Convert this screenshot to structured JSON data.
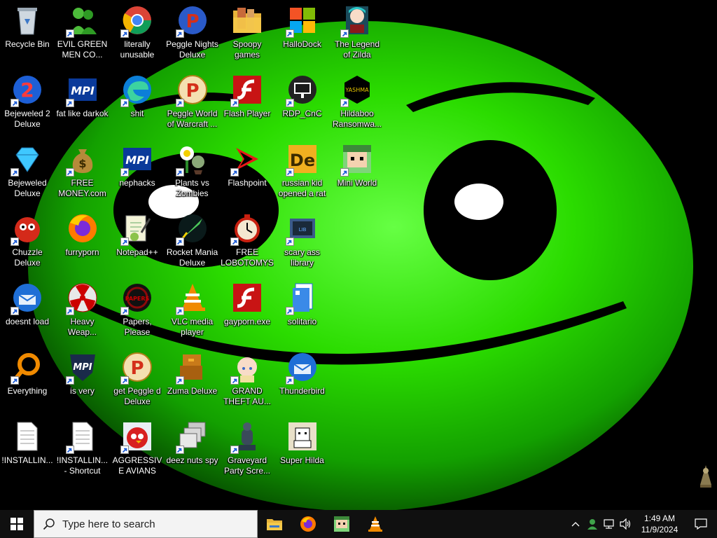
{
  "desktop": {
    "icons": [
      {
        "label": "Recycle Bin",
        "icon": "recycle-bin-icon",
        "shortcut": false
      },
      {
        "label": "Bejeweled 2 Deluxe",
        "icon": "bejeweled-2-icon",
        "shortcut": true
      },
      {
        "label": "Bejeweled Deluxe",
        "icon": "diamond-icon",
        "shortcut": true
      },
      {
        "label": "Chuzzle Deluxe",
        "icon": "chuzzle-icon",
        "shortcut": true
      },
      {
        "label": "doesnt load",
        "icon": "thunderbird-icon",
        "shortcut": true
      },
      {
        "label": "Everything",
        "icon": "everything-search-icon",
        "shortcut": true
      },
      {
        "label": "!INSTALLIN...",
        "icon": "text-file-icon",
        "shortcut": false
      },
      {
        "label": "EVIL GREEN MEN CO...",
        "icon": "green-men-icon",
        "shortcut": true
      },
      {
        "label": "fat like darkok",
        "icon": "mpi-icon",
        "shortcut": true
      },
      {
        "label": "FREE MONEY.com",
        "icon": "money-bag-icon",
        "shortcut": true
      },
      {
        "label": "furryporn",
        "icon": "firefox-icon",
        "shortcut": false
      },
      {
        "label": "Heavy Weap...",
        "icon": "radiation-icon",
        "shortcut": true
      },
      {
        "label": "is very",
        "icon": "mpi-shield-icon",
        "shortcut": true
      },
      {
        "label": "!INSTALLIN... - Shortcut",
        "icon": "text-file-icon",
        "shortcut": true
      },
      {
        "label": "literally unusable",
        "icon": "chrome-icon",
        "shortcut": true
      },
      {
        "label": "shit",
        "icon": "edge-icon",
        "shortcut": true
      },
      {
        "label": "nephacks",
        "icon": "mpi-icon",
        "shortcut": true
      },
      {
        "label": "Notepad++",
        "icon": "notepad-plus-plus-icon",
        "shortcut": true
      },
      {
        "label": "Papers, Please",
        "icon": "papers-please-icon",
        "shortcut": true
      },
      {
        "label": "get Peggle d Deluxe",
        "icon": "peggle-icon",
        "shortcut": true
      },
      {
        "label": "AGGRESSIVE AVIANS",
        "icon": "angry-bird-icon",
        "shortcut": true
      },
      {
        "label": "Peggle Nights Deluxe",
        "icon": "peggle-nights-icon",
        "shortcut": true
      },
      {
        "label": "Peggle World of Warcraft ...",
        "icon": "peggle-icon",
        "shortcut": true
      },
      {
        "label": "Plants vs Zombies",
        "icon": "plants-vs-zombies-icon",
        "shortcut": true
      },
      {
        "label": "Rocket Mania Deluxe",
        "icon": "rocket-mania-icon",
        "shortcut": true
      },
      {
        "label": "VLC media player",
        "icon": "vlc-icon",
        "shortcut": true
      },
      {
        "label": "Zuma Deluxe",
        "icon": "zuma-icon",
        "shortcut": true
      },
      {
        "label": "deez nuts spy",
        "icon": "windows-stack-icon",
        "shortcut": true
      },
      {
        "label": "Spoopy games",
        "icon": "folder-icon",
        "shortcut": false
      },
      {
        "label": "Flash Player",
        "icon": "flash-icon",
        "shortcut": true
      },
      {
        "label": "Flashpoint",
        "icon": "flashpoint-icon",
        "shortcut": true
      },
      {
        "label": "FREE LOBOTOMYS",
        "icon": "clock-icon",
        "shortcut": true
      },
      {
        "label": "gayporn.exe",
        "icon": "flash-icon",
        "shortcut": false
      },
      {
        "label": "GRAND THEFT AU...",
        "icon": "anime-girl-icon",
        "shortcut": true
      },
      {
        "label": "Graveyard Party Scre...",
        "icon": "graveyard-icon",
        "shortcut": true
      },
      {
        "label": "HalloDock",
        "icon": "shield-icon",
        "shortcut": true
      },
      {
        "label": "RDP_CnC",
        "icon": "rdp-icon",
        "shortcut": true
      },
      {
        "label": "russian kid opened a rat",
        "icon": "de-icon",
        "shortcut": true
      },
      {
        "label": "scary ass library",
        "icon": "library-icon",
        "shortcut": true
      },
      {
        "label": "solitario",
        "icon": "solitaire-icon",
        "shortcut": true
      },
      {
        "label": "Thunderbird",
        "icon": "thunderbird-icon",
        "shortcut": true
      },
      {
        "label": "Super Hilda",
        "icon": "pixel-hilda-icon",
        "shortcut": false
      },
      {
        "label": "The Legend of Zilda",
        "icon": "zilda-icon",
        "shortcut": true
      },
      {
        "label": "Hildaboo Ransomwa...",
        "icon": "yashma-icon",
        "shortcut": true
      },
      {
        "label": "Mini World",
        "icon": "mini-world-icon",
        "shortcut": true
      }
    ]
  },
  "taskbar": {
    "search_placeholder": "Type here to search",
    "pinned": [
      {
        "name": "file-explorer-icon",
        "active": false
      },
      {
        "name": "firefox-icon",
        "active": false
      },
      {
        "name": "mini-world-icon",
        "active": false
      },
      {
        "name": "vlc-icon",
        "active": false
      }
    ],
    "clock": {
      "time": "1:49 AM",
      "date": "11/9/2024"
    }
  },
  "colors": {
    "wallpaper_green": "#2dd000",
    "taskbar": "#101010",
    "search_box": "#f3f3f3"
  }
}
